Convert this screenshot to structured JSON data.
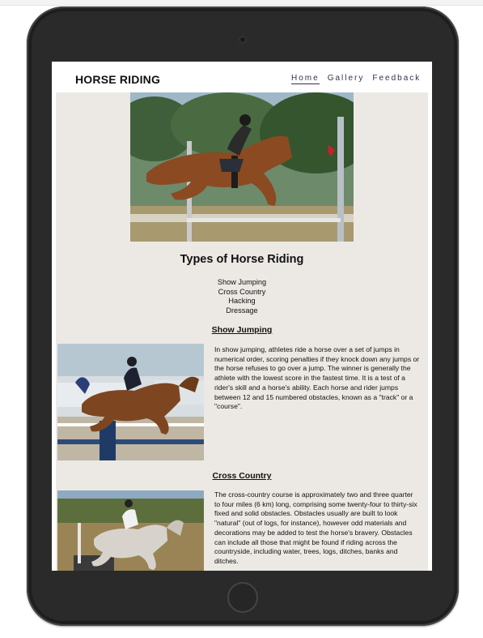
{
  "site": {
    "title": "HORSE RIDING",
    "nav": [
      {
        "label": "Home",
        "active": true
      },
      {
        "label": "Gallery",
        "active": false
      },
      {
        "label": "Feedback",
        "active": false
      }
    ]
  },
  "main": {
    "heading": "Types of Horse Riding",
    "types": [
      "Show Jumping",
      "Cross Country",
      "Hacking",
      "Dressage"
    ],
    "sections": [
      {
        "title": "Show Jumping",
        "text": "In show jumping, athletes ride a horse over a set of jumps in numerical order, scoring penalties if they knock down any jumps or the horse refuses to go over a jump. The winner is generally the athlete with the lowest score in the fastest time. It is a test of a rider's skill and a horse's ability. Each horse and rider jumps between 12 and 15 numbered obstacles, known as a \"track\" or a \"course\"."
      },
      {
        "title": "Cross Country",
        "text": "The cross-country course is approximately two and three quarter to four miles (6 km) long, comprising some twenty-four to thirty-six fixed and solid obstacles. Obstacles usually are built to look \"natural\" (out of logs, for instance), however odd materials and decorations may be added to test the horse's bravery. Obstacles can include all those that might be found if riding across the countryside, including water, trees, logs, ditches, banks and ditches."
      }
    ]
  },
  "colors": {
    "page_bg": "#ece9e4",
    "nav_text": "#3b2c4f",
    "device_frame": "#2a2a2a"
  }
}
